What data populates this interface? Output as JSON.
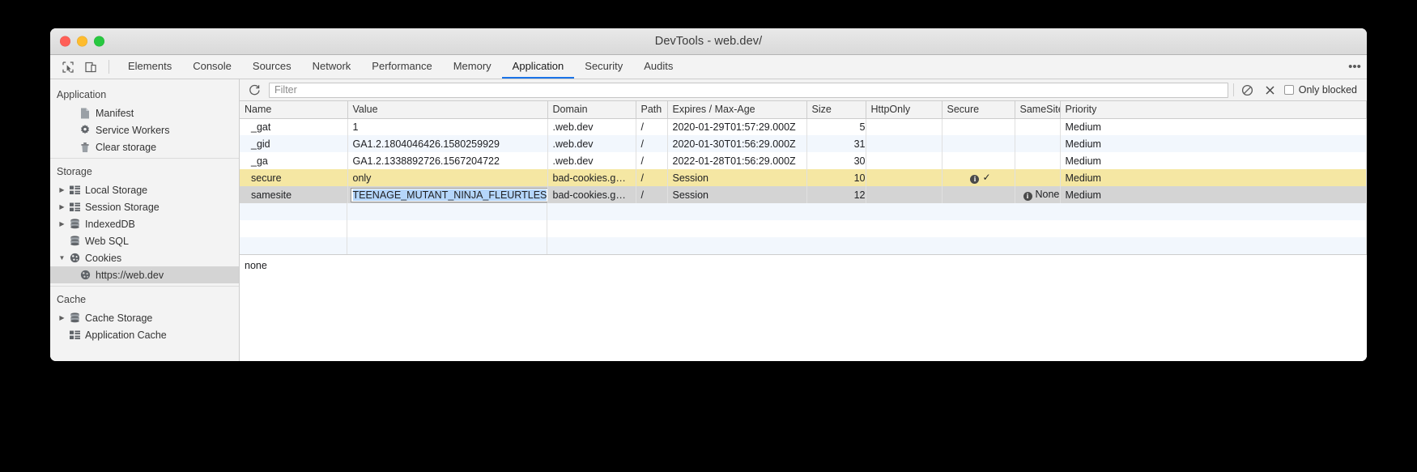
{
  "window": {
    "title": "DevTools - web.dev/",
    "traffic_lights": [
      "close",
      "minimize",
      "maximize"
    ]
  },
  "tabstrip": {
    "inspect_icon": "inspect-element-icon",
    "device_icon": "device-toolbar-icon",
    "menu_icon": "kebab-menu-icon",
    "tabs": [
      {
        "label": "Elements",
        "active": false
      },
      {
        "label": "Console",
        "active": false
      },
      {
        "label": "Sources",
        "active": false
      },
      {
        "label": "Network",
        "active": false
      },
      {
        "label": "Performance",
        "active": false
      },
      {
        "label": "Memory",
        "active": false
      },
      {
        "label": "Application",
        "active": true
      },
      {
        "label": "Security",
        "active": false
      },
      {
        "label": "Audits",
        "active": false
      }
    ]
  },
  "sidebar": {
    "sections": [
      {
        "title": "Application",
        "items": [
          {
            "label": "Manifest",
            "icon": "manifest-file-icon",
            "twisty": "none",
            "indent": 1,
            "selected": false
          },
          {
            "label": "Service Workers",
            "icon": "gear-icon",
            "twisty": "none",
            "indent": 1,
            "selected": false
          },
          {
            "label": "Clear storage",
            "icon": "trash-icon",
            "twisty": "none",
            "indent": 1,
            "selected": false
          }
        ]
      },
      {
        "title": "Storage",
        "items": [
          {
            "label": "Local Storage",
            "icon": "table-grid-icon",
            "twisty": "collapsed",
            "indent": 0,
            "selected": false
          },
          {
            "label": "Session Storage",
            "icon": "table-grid-icon",
            "twisty": "collapsed",
            "indent": 0,
            "selected": false
          },
          {
            "label": "IndexedDB",
            "icon": "database-icon",
            "twisty": "collapsed",
            "indent": 0,
            "selected": false
          },
          {
            "label": "Web SQL",
            "icon": "database-icon",
            "twisty": "none",
            "indent": 0,
            "selected": false
          },
          {
            "label": "Cookies",
            "icon": "cookie-icon",
            "twisty": "expanded",
            "indent": 0,
            "selected": false
          },
          {
            "label": "https://web.dev",
            "icon": "cookie-icon",
            "twisty": "none",
            "indent": 2,
            "selected": true
          }
        ]
      },
      {
        "title": "Cache",
        "items": [
          {
            "label": "Cache Storage",
            "icon": "database-icon",
            "twisty": "collapsed",
            "indent": 0,
            "selected": false
          },
          {
            "label": "Application Cache",
            "icon": "table-grid-icon",
            "twisty": "none",
            "indent": 1,
            "selected": false
          }
        ]
      }
    ]
  },
  "toolbar": {
    "refresh_icon": "refresh-icon",
    "filter_placeholder": "Filter",
    "filter_value": "",
    "clear_all_icon": "block-clear-icon",
    "delete_icon": "close-x-icon",
    "only_blocked_label": "Only blocked",
    "only_blocked_checked": false
  },
  "table": {
    "columns": [
      "Name",
      "Value",
      "Domain",
      "Path",
      "Expires / Max-Age",
      "Size",
      "HttpOnly",
      "Secure",
      "SameSite",
      "Priority"
    ],
    "rows": [
      {
        "name": "_gat",
        "value": "1",
        "domain": ".web.dev",
        "path": "/",
        "expires": "2020-01-29T01:57:29.000Z",
        "size": "5",
        "httponly": "",
        "secure": "",
        "samesite": "",
        "priority": "Medium",
        "state": "odd"
      },
      {
        "name": "_gid",
        "value": "GA1.2.1804046426.1580259929",
        "domain": ".web.dev",
        "path": "/",
        "expires": "2020-01-30T01:56:29.000Z",
        "size": "31",
        "httponly": "",
        "secure": "",
        "samesite": "",
        "priority": "Medium",
        "state": "even"
      },
      {
        "name": "_ga",
        "value": "GA1.2.1338892726.1567204722",
        "domain": ".web.dev",
        "path": "/",
        "expires": "2022-01-28T01:56:29.000Z",
        "size": "30",
        "httponly": "",
        "secure": "",
        "samesite": "",
        "priority": "Medium",
        "state": "odd"
      },
      {
        "name": "secure",
        "value": "only",
        "domain": "bad-cookies.g…",
        "path": "/",
        "expires": "Session",
        "size": "10",
        "httponly": "",
        "secure": "✓",
        "secure_info": true,
        "samesite": "",
        "priority": "Medium",
        "state": "highlight"
      },
      {
        "name": "samesite",
        "value": "TEENAGE_MUTANT_NINJA_FLEURTLES",
        "value_editing": true,
        "domain": "bad-cookies.g…",
        "path": "/",
        "expires": "Session",
        "size": "12",
        "httponly": "",
        "secure": "",
        "samesite": "None",
        "samesite_info": true,
        "priority": "Medium",
        "state": "selected"
      }
    ]
  },
  "preview": {
    "text": "none"
  },
  "colors": {
    "accent": "#1a73e8",
    "highlight_row": "#f5e7a3",
    "selected_row": "#d4d4d4",
    "alt_row": "#f2f7fd",
    "selection": "#b5d6fb"
  }
}
